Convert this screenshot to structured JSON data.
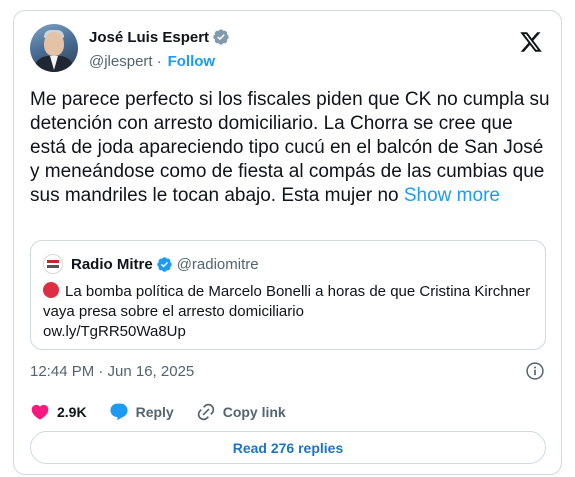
{
  "author": {
    "name": "José Luis Espert",
    "handle": "@jlespert",
    "separator": "·",
    "follow_label": "Follow"
  },
  "icons": {
    "avatar": "avatar",
    "verified": "verified-badge-icon",
    "platform": "x-logo-icon",
    "info": "info-icon",
    "like": "heart-icon",
    "reply": "reply-bubble-icon",
    "link": "link-icon"
  },
  "colors": {
    "accent": "#1d9bf0",
    "like": "#f91880",
    "text": "#0f1419",
    "muted": "#536471",
    "border": "#cfd9de"
  },
  "tweet": {
    "text": "Me parece perfecto si los fiscales piden que CK no cumpla su detención con arresto domiciliario. La Chorra se cree que está de joda apareciendo tipo cucú en el balcón de San José y meneándose como de fiesta al compás de las cumbias que sus mandriles le tocan abajo. Esta mujer no",
    "show_more": "Show more"
  },
  "quote": {
    "name": "Radio Mitre",
    "handle": "@radiomitre",
    "text": "La bomba política de Marcelo Bonelli a horas de que Cristina Kirchner vaya presa sobre el arresto domiciliario",
    "link": "ow.ly/TgRR50Wa8Up"
  },
  "meta": {
    "timestamp": "12:44 PM · Jun 16, 2025"
  },
  "actions": {
    "likes": "2.9K",
    "reply_label": "Reply",
    "copy_link_label": "Copy link"
  },
  "footer": {
    "read_replies": "Read 276 replies"
  }
}
